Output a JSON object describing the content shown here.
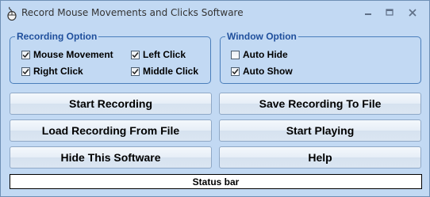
{
  "window": {
    "title": "Record Mouse Movements and Clicks Software",
    "icon": "app-icon",
    "controls": [
      "minimize-icon",
      "maximize-icon",
      "close-icon"
    ]
  },
  "recording_option": {
    "title": "Recording Option",
    "items": [
      {
        "label": "Mouse Movement",
        "checked": true
      },
      {
        "label": "Left Click",
        "checked": true
      },
      {
        "label": "Right Click",
        "checked": true
      },
      {
        "label": "Middle Click",
        "checked": true
      }
    ]
  },
  "window_option": {
    "title": "Window Option",
    "items": [
      {
        "label": "Auto Hide",
        "checked": false
      },
      {
        "label": "Auto Show",
        "checked": true
      }
    ]
  },
  "buttons": {
    "start_recording": "Start Recording",
    "save_recording": "Save Recording To File",
    "load_recording": "Load Recording From File",
    "start_playing": "Start Playing",
    "hide_software": "Hide This Software",
    "help": "Help"
  },
  "status_bar": "Status bar",
  "colors": {
    "window_bg": "#c2d9f3",
    "group_title": "#1f4f9c",
    "group_border": "#4a7ebb"
  }
}
